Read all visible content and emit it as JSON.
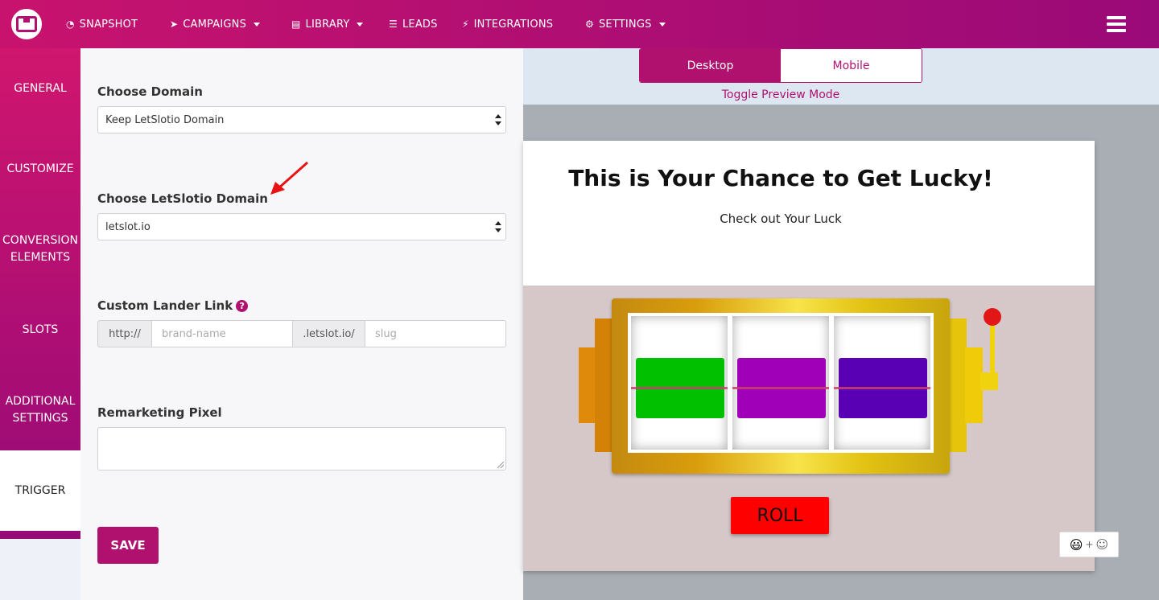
{
  "nav": {
    "items": [
      {
        "label": "SNAPSHOT",
        "icon": "dashboard-icon",
        "dropdown": false
      },
      {
        "label": "CAMPAIGNS",
        "icon": "paper-plane-icon",
        "dropdown": true
      },
      {
        "label": "LIBRARY",
        "icon": "library-icon",
        "dropdown": true
      },
      {
        "label": "LEADS",
        "icon": "list-icon",
        "dropdown": false
      },
      {
        "label": "INTEGRATIONS",
        "icon": "plug-icon",
        "dropdown": false
      },
      {
        "label": "SETTINGS",
        "icon": "cogs-icon",
        "dropdown": true
      }
    ]
  },
  "sidebar": {
    "items": [
      {
        "label": "GENERAL"
      },
      {
        "label": "CUSTOMIZE"
      },
      {
        "label": "CONVERSION ELEMENTS"
      },
      {
        "label": "SLOTS"
      },
      {
        "label": "ADDITIONAL SETTINGS"
      },
      {
        "label": "TRIGGER",
        "active": true
      }
    ]
  },
  "form": {
    "domain_label": "Choose Domain",
    "domain_value": "Keep LetSlotio Domain",
    "letslotio_domain_label": "Choose LetSlotio Domain",
    "letslotio_domain_value": "letslot.io",
    "lander_label": "Custom Lander Link",
    "lander_prefix": "http://",
    "lander_brand_placeholder": "brand-name",
    "lander_middle": ".letslot.io/",
    "lander_slug_placeholder": "slug",
    "pixel_label": "Remarketing Pixel",
    "pixel_value": "",
    "save_label": "SAVE"
  },
  "preview": {
    "toggle_desktop": "Desktop",
    "toggle_mobile": "Mobile",
    "toggle_caption": "Toggle Preview Mode",
    "title": "This is Your Chance to Get Lucky!",
    "subtitle": "Check out Your Luck",
    "roll_label": "ROLL",
    "symbol_colors": [
      "#00c000",
      "#a000b8",
      "#5a00b4"
    ]
  },
  "colors": {
    "brand": "#b0116f",
    "annotation_arrow": "#e81212"
  }
}
